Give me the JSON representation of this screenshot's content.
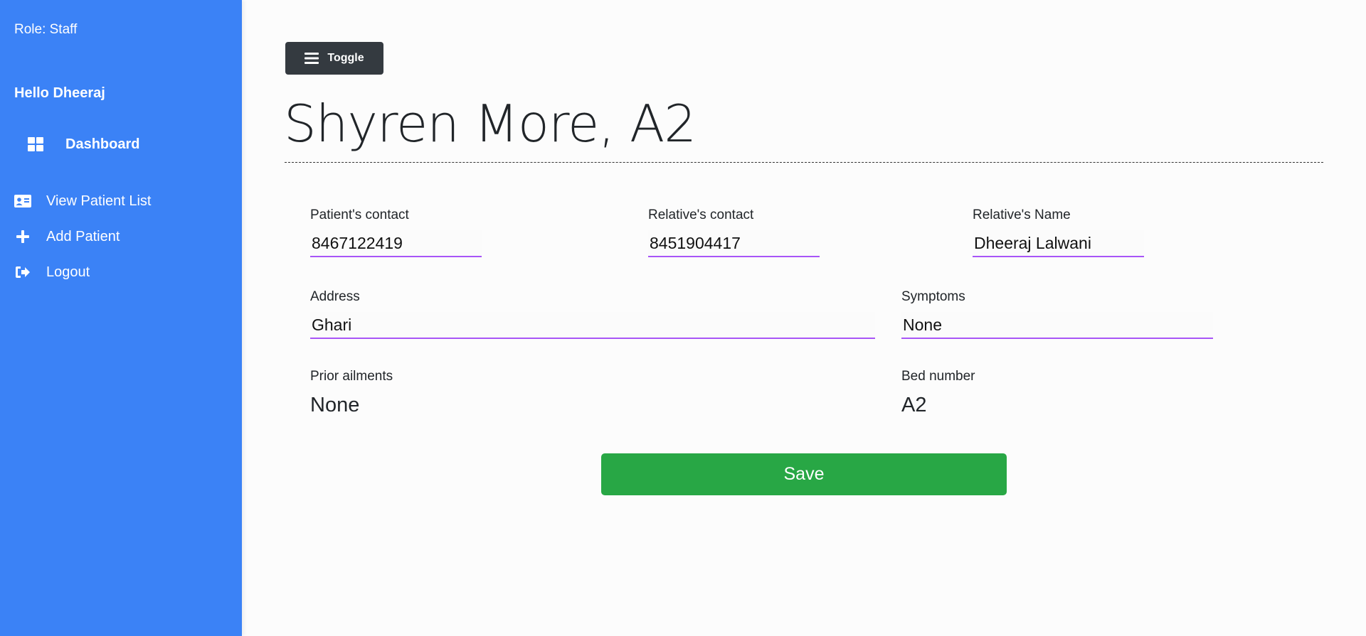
{
  "sidebar": {
    "role": "Role: Staff",
    "greeting": "Hello Dheeraj",
    "items": [
      {
        "label": "Dashboard",
        "icon": "dashboard-grid-icon"
      },
      {
        "label": "View Patient List",
        "icon": "id-card-icon"
      },
      {
        "label": "Add Patient",
        "icon": "plus-icon"
      },
      {
        "label": "Logout",
        "icon": "sign-out-icon"
      }
    ],
    "background_color": "#3b82f6"
  },
  "toolbar": {
    "toggle_label": "Toggle",
    "toggle_icon": "hamburger-menu-icon"
  },
  "page": {
    "title": "Shyren More, A2"
  },
  "form": {
    "patient_contact": {
      "label": "Patient's contact",
      "value": "8467122419"
    },
    "relative_contact": {
      "label": "Relative's contact",
      "value": "8451904417"
    },
    "relative_name": {
      "label": "Relative's Name",
      "value": "Dheeraj Lalwani"
    },
    "address": {
      "label": "Address",
      "value": "Ghari"
    },
    "symptoms": {
      "label": "Symptoms",
      "value": "None"
    },
    "prior_ailments": {
      "label": "Prior ailments",
      "value": "None"
    },
    "bed_number": {
      "label": "Bed number",
      "value": "A2"
    },
    "input_underline_color": "#a855f7",
    "save_label": "Save",
    "save_color": "#28a745"
  }
}
